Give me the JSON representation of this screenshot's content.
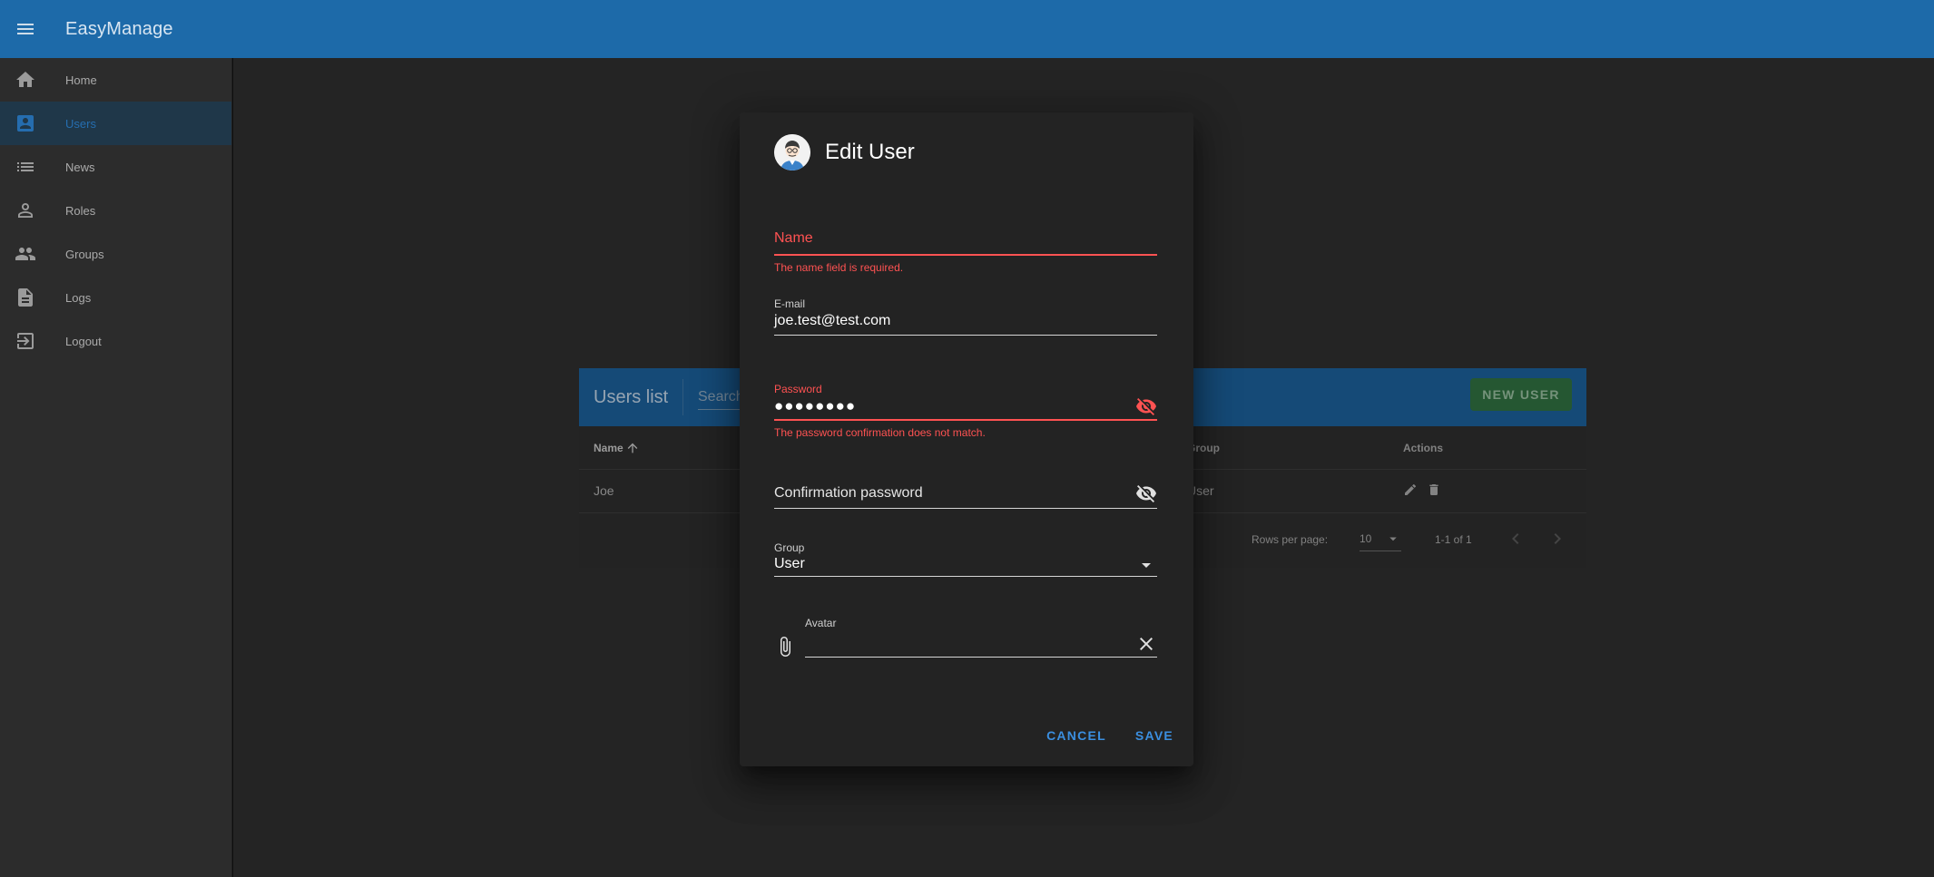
{
  "app": {
    "title": "EasyManage"
  },
  "sidebar": {
    "items": [
      {
        "label": "Home",
        "icon": "home-icon"
      },
      {
        "label": "Users",
        "icon": "user-card-icon",
        "active": true
      },
      {
        "label": "News",
        "icon": "list-icon"
      },
      {
        "label": "Roles",
        "icon": "person-icon"
      },
      {
        "label": "Groups",
        "icon": "people-icon"
      },
      {
        "label": "Logs",
        "icon": "document-icon"
      },
      {
        "label": "Logout",
        "icon": "logout-icon"
      }
    ]
  },
  "users_card": {
    "title": "Users list",
    "search_placeholder": "Search",
    "new_user_label": "NEW USER",
    "columns": {
      "name": "Name",
      "group": "Group",
      "actions": "Actions"
    },
    "rows": [
      {
        "name": "Joe",
        "group": "User"
      }
    ],
    "footer": {
      "rows_per_page_label": "Rows per page:",
      "rows_per_page": "10",
      "range": "1-1 of 1"
    }
  },
  "dialog": {
    "title": "Edit User",
    "name_field": {
      "label": "Name",
      "value": "",
      "error": "The name field is required."
    },
    "email_field": {
      "label": "E-mail",
      "value": "joe.test@test.com"
    },
    "password_field": {
      "label": "Password",
      "value": "●●●●●●●●",
      "error": "The password confirmation does not match."
    },
    "confirm_field": {
      "label": "Confirmation password",
      "value": ""
    },
    "group_field": {
      "label": "Group",
      "value": "User"
    },
    "avatar_field": {
      "label": "Avatar",
      "value": ""
    },
    "cancel_label": "CANCEL",
    "save_label": "SAVE"
  },
  "colors": {
    "appbar": "#1d6aa9",
    "sidebar": "#363636",
    "accent": "#2e86d6",
    "error": "#ff5252",
    "new_user_button": "#2e6b3d",
    "dialog_bg": "#232323"
  }
}
